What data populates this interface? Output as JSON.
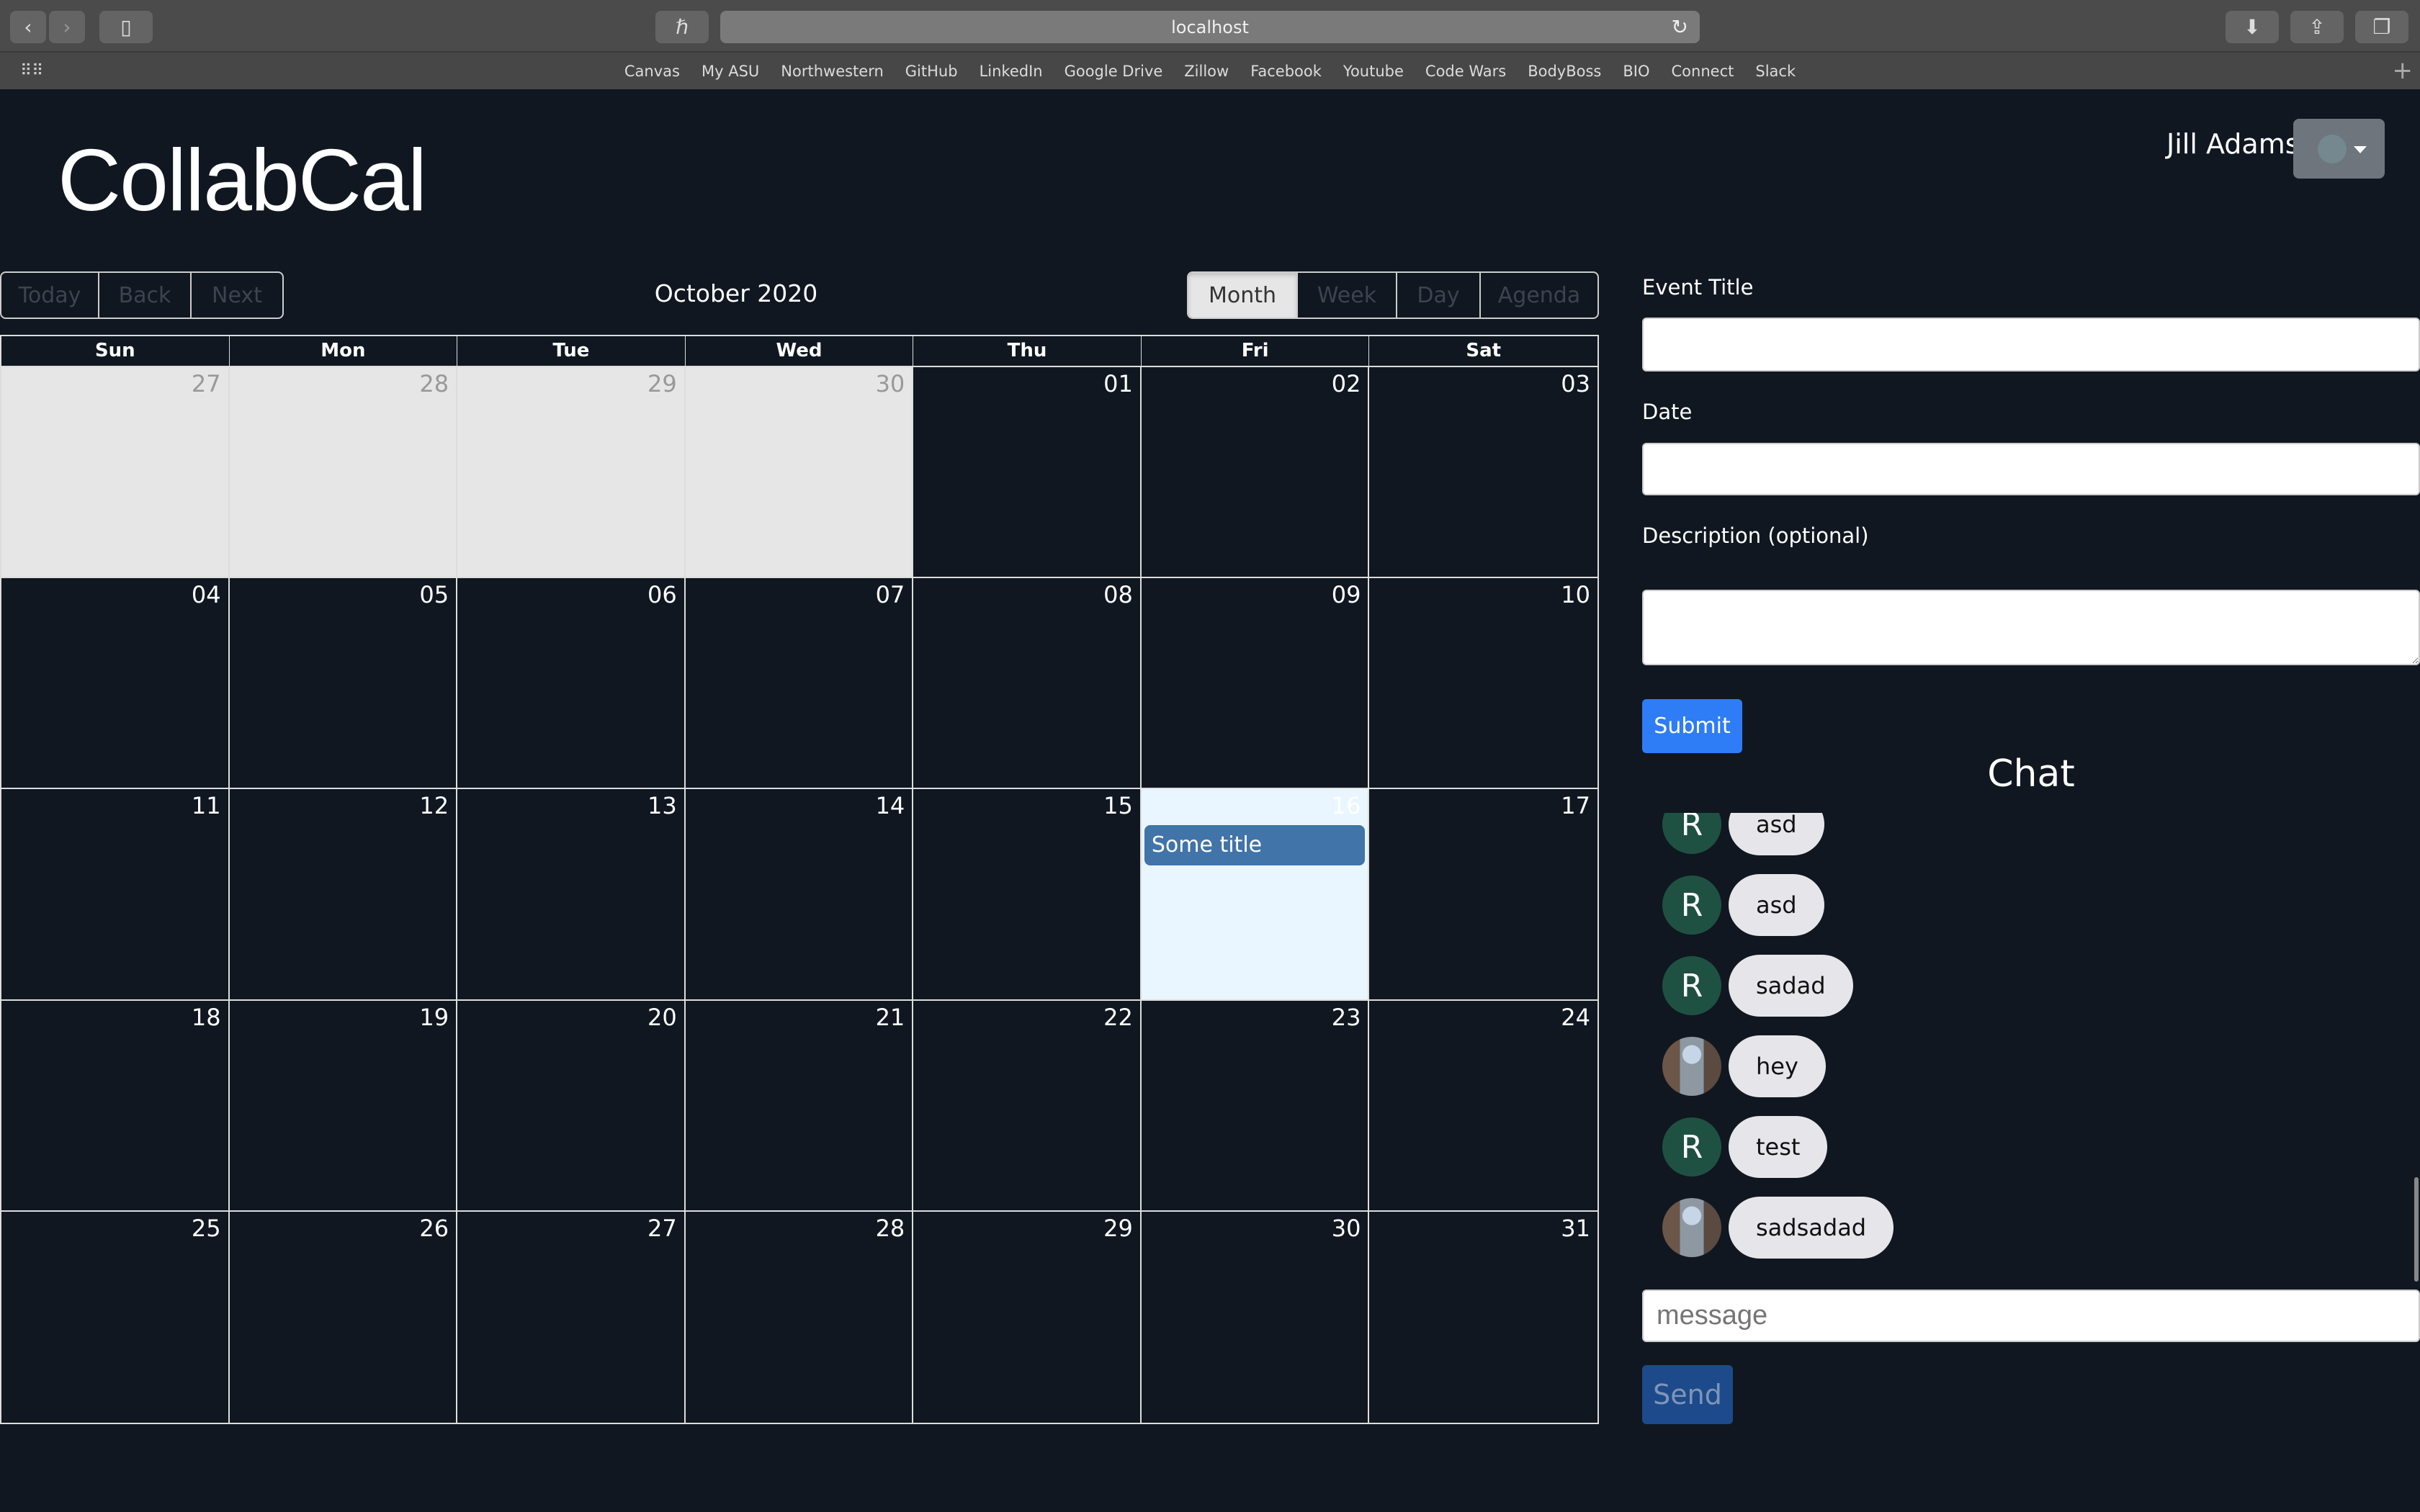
{
  "browser": {
    "url": "localhost",
    "bookmarks": [
      "Canvas",
      "My ASU",
      "Northwestern",
      "GitHub",
      "LinkedIn",
      "Google Drive",
      "Zillow",
      "Facebook",
      "Youtube",
      "Code Wars",
      "BodyBoss",
      "BIO",
      "Connect",
      "Slack"
    ]
  },
  "app": {
    "title": "CollabCal"
  },
  "user": {
    "name": "Jill Adams"
  },
  "toolbar": {
    "nav": [
      "Today",
      "Back",
      "Next"
    ],
    "label": "October 2020",
    "views": [
      "Month",
      "Week",
      "Day",
      "Agenda"
    ],
    "active_view": "Month"
  },
  "calendar": {
    "weekdays": [
      "Sun",
      "Mon",
      "Tue",
      "Wed",
      "Thu",
      "Fri",
      "Sat"
    ],
    "days": [
      {
        "n": "27",
        "off": true
      },
      {
        "n": "28",
        "off": true
      },
      {
        "n": "29",
        "off": true
      },
      {
        "n": "30",
        "off": true
      },
      {
        "n": "01"
      },
      {
        "n": "02"
      },
      {
        "n": "03"
      },
      {
        "n": "04"
      },
      {
        "n": "05"
      },
      {
        "n": "06"
      },
      {
        "n": "07"
      },
      {
        "n": "08"
      },
      {
        "n": "09"
      },
      {
        "n": "10"
      },
      {
        "n": "11"
      },
      {
        "n": "12"
      },
      {
        "n": "13"
      },
      {
        "n": "14"
      },
      {
        "n": "15"
      },
      {
        "n": "16",
        "today": true,
        "event": "Some title"
      },
      {
        "n": "17"
      },
      {
        "n": "18"
      },
      {
        "n": "19"
      },
      {
        "n": "20"
      },
      {
        "n": "21"
      },
      {
        "n": "22"
      },
      {
        "n": "23"
      },
      {
        "n": "24"
      },
      {
        "n": "25"
      },
      {
        "n": "26"
      },
      {
        "n": "27"
      },
      {
        "n": "28"
      },
      {
        "n": "29"
      },
      {
        "n": "30"
      },
      {
        "n": "31"
      }
    ]
  },
  "form": {
    "event_title_label": "Event Title",
    "event_title_value": "",
    "date_label": "Date",
    "date_value": "",
    "description_label": "Description (optional)",
    "description_value": "",
    "submit_label": "Submit"
  },
  "chat": {
    "title": "Chat",
    "messages": [
      {
        "avatar": "R",
        "text": "asd"
      },
      {
        "avatar": "R",
        "text": "asd"
      },
      {
        "avatar": "R",
        "text": "sadad"
      },
      {
        "avatar": "photo",
        "text": "hey"
      },
      {
        "avatar": "R",
        "text": "test"
      },
      {
        "avatar": "photo",
        "text": "sadsadad"
      }
    ],
    "placeholder": "message",
    "send_label": "Send"
  },
  "colors": {
    "background": "#101720",
    "event": "#4174a8",
    "submit": "#2e7cf6",
    "send": "#1d4a8a",
    "avatar": "#1f5142",
    "today": "#eaf6ff"
  }
}
